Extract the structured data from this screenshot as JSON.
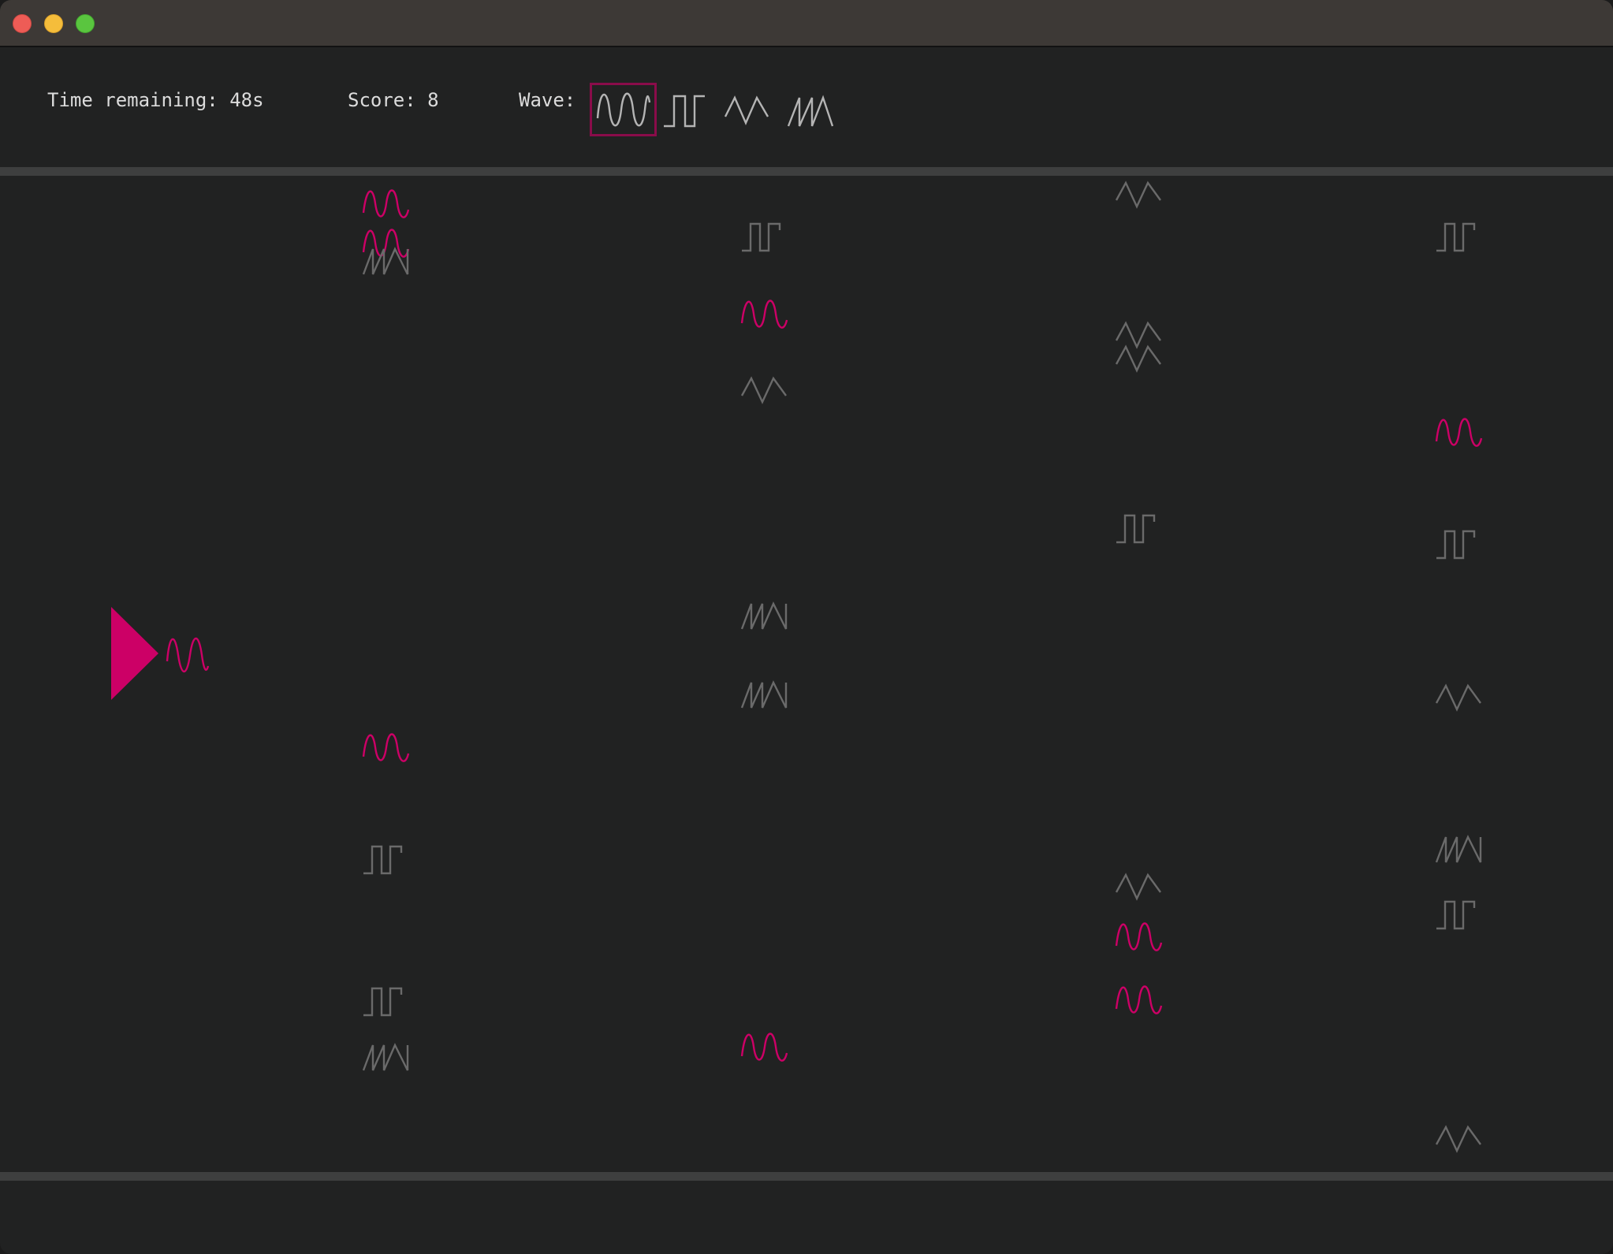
{
  "window": {
    "controls": [
      "close",
      "minimize",
      "maximize"
    ],
    "colors": {
      "close": "#ee5c56",
      "minimize": "#f5bd3b",
      "maximize": "#5ac53f"
    }
  },
  "hud": {
    "time_label": "Time remaining: 48s",
    "score_label": "Score: 8",
    "wave_label": "Wave:",
    "waves": [
      {
        "name": "sine-wave-icon",
        "selected": true
      },
      {
        "name": "square-wave-icon",
        "selected": false
      },
      {
        "name": "triangle-wave-icon",
        "selected": false
      },
      {
        "name": "sawtooth-wave-icon",
        "selected": false
      }
    ]
  },
  "player": {
    "icon": "play-triangle-icon",
    "wave": "sine-wave-icon"
  },
  "colors": {
    "accent": "#cc0066",
    "inactive_wave": "#6a6a6a",
    "background": "#212222",
    "divider": "#3e3f3f",
    "hud_text": "#dcdcdc"
  },
  "obstacle_waves": [
    "sine",
    "sine",
    "sawtooth",
    "square",
    "sine",
    "triangle",
    "sine",
    "square",
    "square",
    "sawtooth",
    "triangle",
    "triangle",
    "triangle",
    "triangle",
    "square",
    "sawtooth",
    "sine",
    "triangle",
    "sine",
    "sine",
    "square",
    "sine",
    "square",
    "triangle",
    "sawtooth",
    "square",
    "triangle"
  ]
}
